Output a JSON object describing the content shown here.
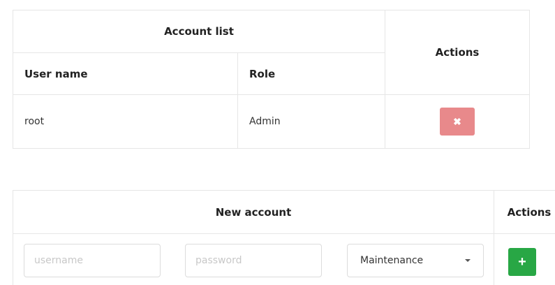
{
  "account_list": {
    "group_header": "Account list",
    "actions_header": "Actions",
    "columns": [
      "User name",
      "Role"
    ],
    "rows": [
      {
        "username": "root",
        "role": "Admin",
        "delete_icon": "✖"
      }
    ]
  },
  "new_account": {
    "header": "New account",
    "actions_header": "Actions",
    "username_placeholder": "username",
    "password_placeholder": "password",
    "role_selected": "Maintenance",
    "add_icon": "+"
  },
  "colors": {
    "delete_button": "#e8898b",
    "add_button": "#28a745"
  }
}
